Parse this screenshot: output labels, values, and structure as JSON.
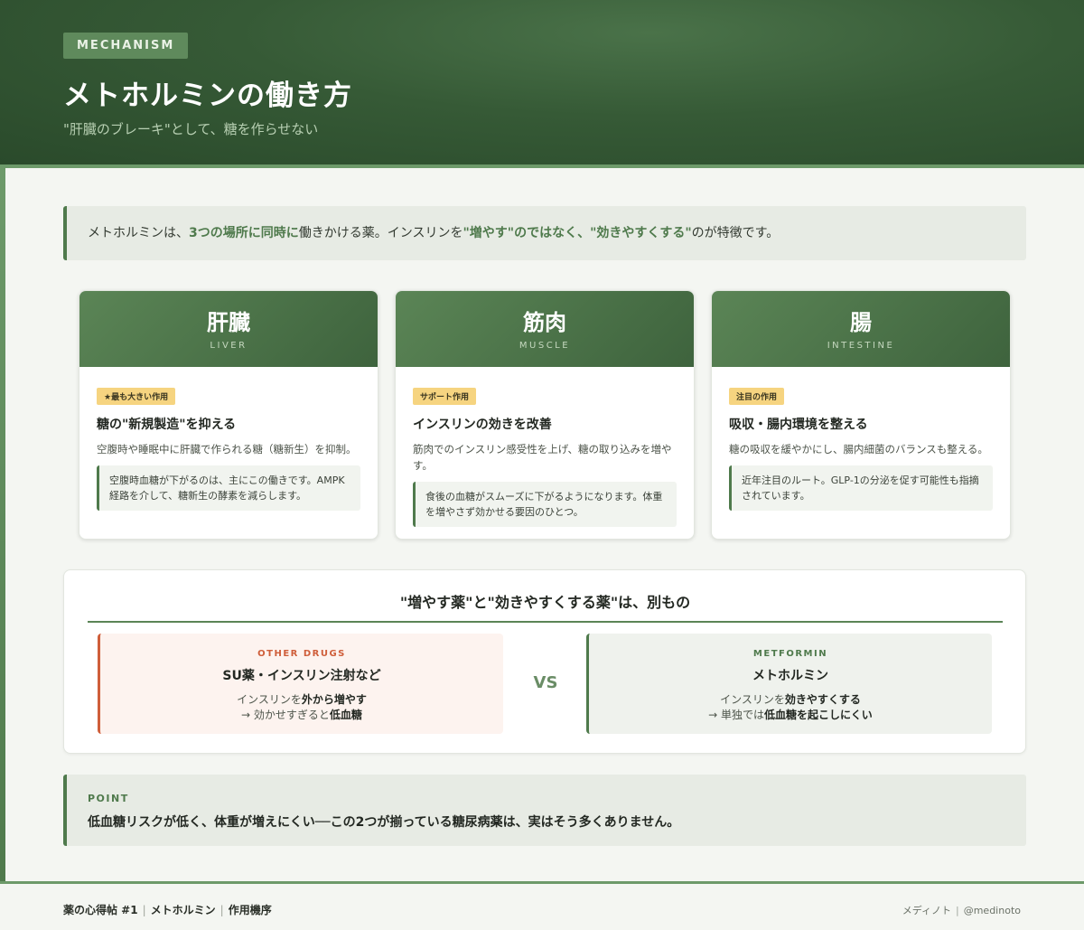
{
  "header": {
    "eyebrow": "MECHANISM",
    "title": "メトホルミンの働き方",
    "subtitle": "\"肝臓のブレーキ\"として、糖を作らせない"
  },
  "intro": {
    "part1": "メトホルミンは、",
    "hl1": "3つの場所に同時に",
    "part2": "働きかける薬。インスリンを",
    "hl2": "\"増やす\"のではなく、\"効きやすくする\"",
    "part3": "のが特徴です。"
  },
  "cards": [
    {
      "name": "肝臓",
      "en": "LIVER",
      "badge": "★最も大きい作用",
      "heading": "糖の\"新規製造\"を抑える",
      "desc": "空腹時や睡眠中に肝臓で作られる糖（糖新生）を抑制。",
      "note": "空腹時血糖が下がるのは、主にこの働きです。AMPK経路を介して、糖新生の酵素を減らします。"
    },
    {
      "name": "筋肉",
      "en": "MUSCLE",
      "badge": "サポート作用",
      "heading": "インスリンの効きを改善",
      "desc": "筋肉でのインスリン感受性を上げ、糖の取り込みを増やす。",
      "note": "食後の血糖がスムーズに下がるようになります。体重を増やさず効かせる要因のひとつ。"
    },
    {
      "name": "腸",
      "en": "INTESTINE",
      "badge": "注目の作用",
      "heading": "吸収・腸内環境を整える",
      "desc": "糖の吸収を緩やかにし、腸内細菌のバランスも整える。",
      "note": "近年注目のルート。GLP-1の分泌を促す可能性も指摘されています。"
    }
  ],
  "compare": {
    "title": "\"増やす薬\"と\"効きやすくする薬\"は、別もの",
    "vs": "VS",
    "other": {
      "tag": "OTHER DRUGS",
      "heading": "SU薬・インスリン注射など",
      "l1a": "インスリンを",
      "l1b": "外から増やす",
      "l2a": "→ 効かせすぎると",
      "l2b": "低血糖"
    },
    "metformin": {
      "tag": "METFORMIN",
      "heading": "メトホルミン",
      "l1a": "インスリンを",
      "l1b": "効きやすくする",
      "l2a": "→ 単独では",
      "l2b": "低血糖を起こしにくい"
    }
  },
  "point": {
    "tag": "POINT",
    "text": "低血糖リスクが低く、体重が増えにくい──この2つが揃っている糖尿病薬は、実はそう多くありません。"
  },
  "footer": {
    "series": "薬の心得帖 #1",
    "drug": "メトホルミン",
    "topic": "作用機序",
    "brand": "メディノト",
    "handle": "@medinoto"
  },
  "colors": {
    "accent": "#4f7a4c",
    "header_dark": "#2a4a2b",
    "badge": "#f6d480",
    "warning": "#cf5e3a"
  }
}
